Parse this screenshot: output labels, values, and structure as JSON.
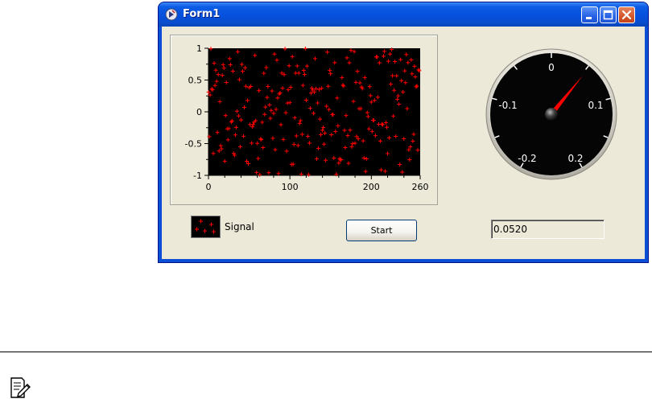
{
  "window": {
    "title": "Form1",
    "icons": {
      "app": "labwindows-app-icon",
      "minimize": "minimize-icon",
      "maximize": "maximize-icon",
      "close": "close-icon"
    },
    "colors": {
      "titlebar": "#0550dc",
      "client": "#ece9d8",
      "close_button": "#d65a2e"
    }
  },
  "graph": {
    "plot_background": "#000000",
    "marker_color": "#ff0000",
    "marker": "+",
    "x_ticks": [
      "0",
      "100",
      "200",
      "260"
    ],
    "y_ticks": [
      "1",
      "0.5",
      "0",
      "-0.5",
      "-1"
    ]
  },
  "chart_data": {
    "type": "scatter",
    "xlim": [
      0,
      260
    ],
    "ylim": [
      -1,
      1
    ],
    "series": [
      {
        "name": "Signal",
        "color": "#ff0000",
        "points": []
      }
    ]
  },
  "legend": {
    "label": "Signal"
  },
  "controls": {
    "start_label": "Start"
  },
  "gauge": {
    "labels": [
      "0",
      "-0.1",
      "0.1",
      "-0.2",
      "0.2"
    ],
    "min": -0.2,
    "max": 0.2,
    "value": 0.052,
    "needle_color": "#ff0000"
  },
  "readout": {
    "value": "0.0520"
  },
  "footer": {
    "icon": "note-icon"
  }
}
